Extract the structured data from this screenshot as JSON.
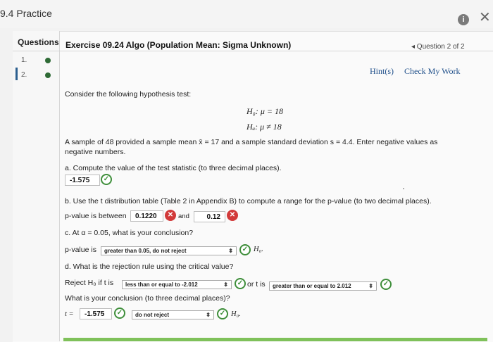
{
  "window": {
    "title": "9.4 Practice",
    "info_icon": "info-icon",
    "close_icon": "close-icon"
  },
  "sidebar": {
    "header": "Questions",
    "items": [
      {
        "label": "1.",
        "status": "complete"
      },
      {
        "label": "2.",
        "status": "complete",
        "selected": true
      }
    ]
  },
  "exercise": {
    "title": "Exercise 09.24 Algo (Population Mean: Sigma Unknown)",
    "question_nav": "◂ Question 2 of 2",
    "hint_label": "Hint(s)",
    "check_label": "Check My Work"
  },
  "problem": {
    "intro": "Consider the following hypothesis test:",
    "h0": "H₀: μ = 18",
    "ha": "Hₐ: μ ≠ 18",
    "sample_line1": "A sample of 48 provided a sample mean x̄ = 17 and a sample standard deviation s = 4.4. Enter negative values as",
    "sample_line2": "negative numbers.",
    "a_prompt": "a. Compute the value of the test statistic (to three decimal places).",
    "a_answer": "-1.575",
    "b_prompt": "b. Use the t distribution table (Table 2 in Appendix B) to compute a range for the p-value (to two decimal places).",
    "b_prefix": "p-value is between",
    "b_low": "0.1220",
    "b_and": "and",
    "b_high": "0.12",
    "c_prompt": "c. At α = 0.05, what is your conclusion?",
    "c_prefix": "p-value is",
    "c_select": "greater than 0.05, do not reject",
    "c_suffix": "H₀.",
    "d_prompt": "d. What is the rejection rule using the critical value?",
    "d_prefix": "Reject H₀ if t is",
    "d_select1": "less than or equal to -2.012",
    "d_or": "or t is",
    "d_select2": "greater than or equal to 2.012",
    "d_question": "What is your conclusion (to three decimal places)?",
    "d_t_label": "t =",
    "d_t_value": "-1.575",
    "d_select3": "do not reject",
    "d_suffix": "H₀."
  }
}
